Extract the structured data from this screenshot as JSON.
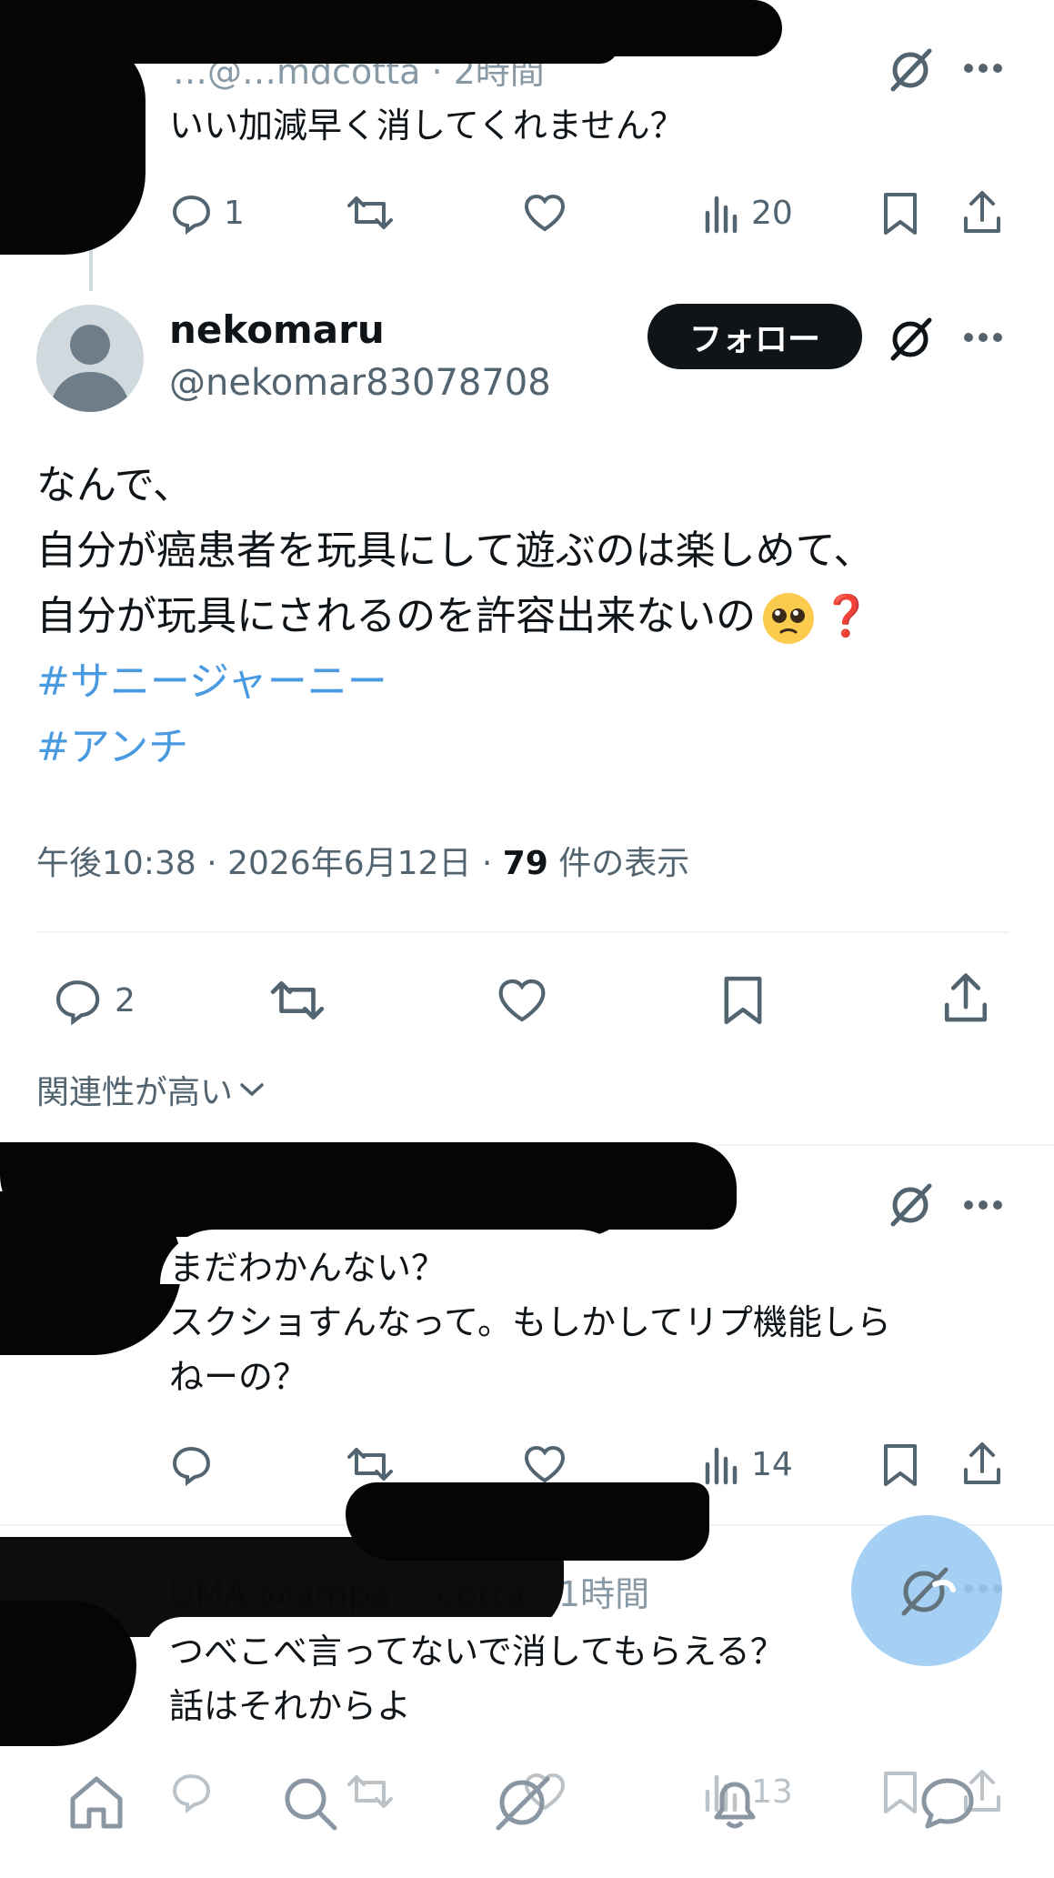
{
  "reply_top": {
    "header_partial": "…@…mdcotta · 2時間",
    "text": "いい加減早く消してくれません？",
    "stats": {
      "replies": "1",
      "views": "20"
    }
  },
  "main_tweet": {
    "display_name": "nekomaru",
    "handle": "@nekomar83078708",
    "follow_label": "フォロー",
    "lines": [
      "なんで、",
      "自分が癌患者を玩具にして遊ぶのは楽しめて、",
      "自分が玩具にされるのを許容出来ないの"
    ],
    "emoji": "🥺",
    "question_mark": "❓",
    "hashtags": [
      "#サニージャーニー",
      "#アンチ"
    ],
    "time": "午後10:38 · 2026年6月12日 · ",
    "views_count": "79",
    "views_label": " 件の表示",
    "stats": {
      "replies": "2"
    }
  },
  "sort": {
    "label": "関連性が高い"
  },
  "reply_2": {
    "lines": [
      "まだわかんない？",
      "スクショすんなって。もしかしてリプ機能しら",
      "ねーの？"
    ],
    "stats": {
      "views": "14"
    }
  },
  "reply_3": {
    "header_partial": "UMA @ampa… cotta · 1時間",
    "lines": [
      "つべこべ言ってないで消してもらえる？",
      "話はそれからよ"
    ],
    "stats": {
      "views": "13"
    }
  },
  "colors": {
    "text": "#0f1419",
    "secondary": "#536471",
    "hashtag": "#4a9ae1",
    "fab": "#9ccbf3"
  },
  "icons": [
    "grok-icon",
    "more-icon",
    "reply-icon",
    "retweet-icon",
    "like-icon",
    "views-icon",
    "bookmark-icon",
    "share-icon",
    "avatar-placeholder",
    "home-icon",
    "search-icon",
    "notifications-icon",
    "messages-icon",
    "compose-icon"
  ]
}
